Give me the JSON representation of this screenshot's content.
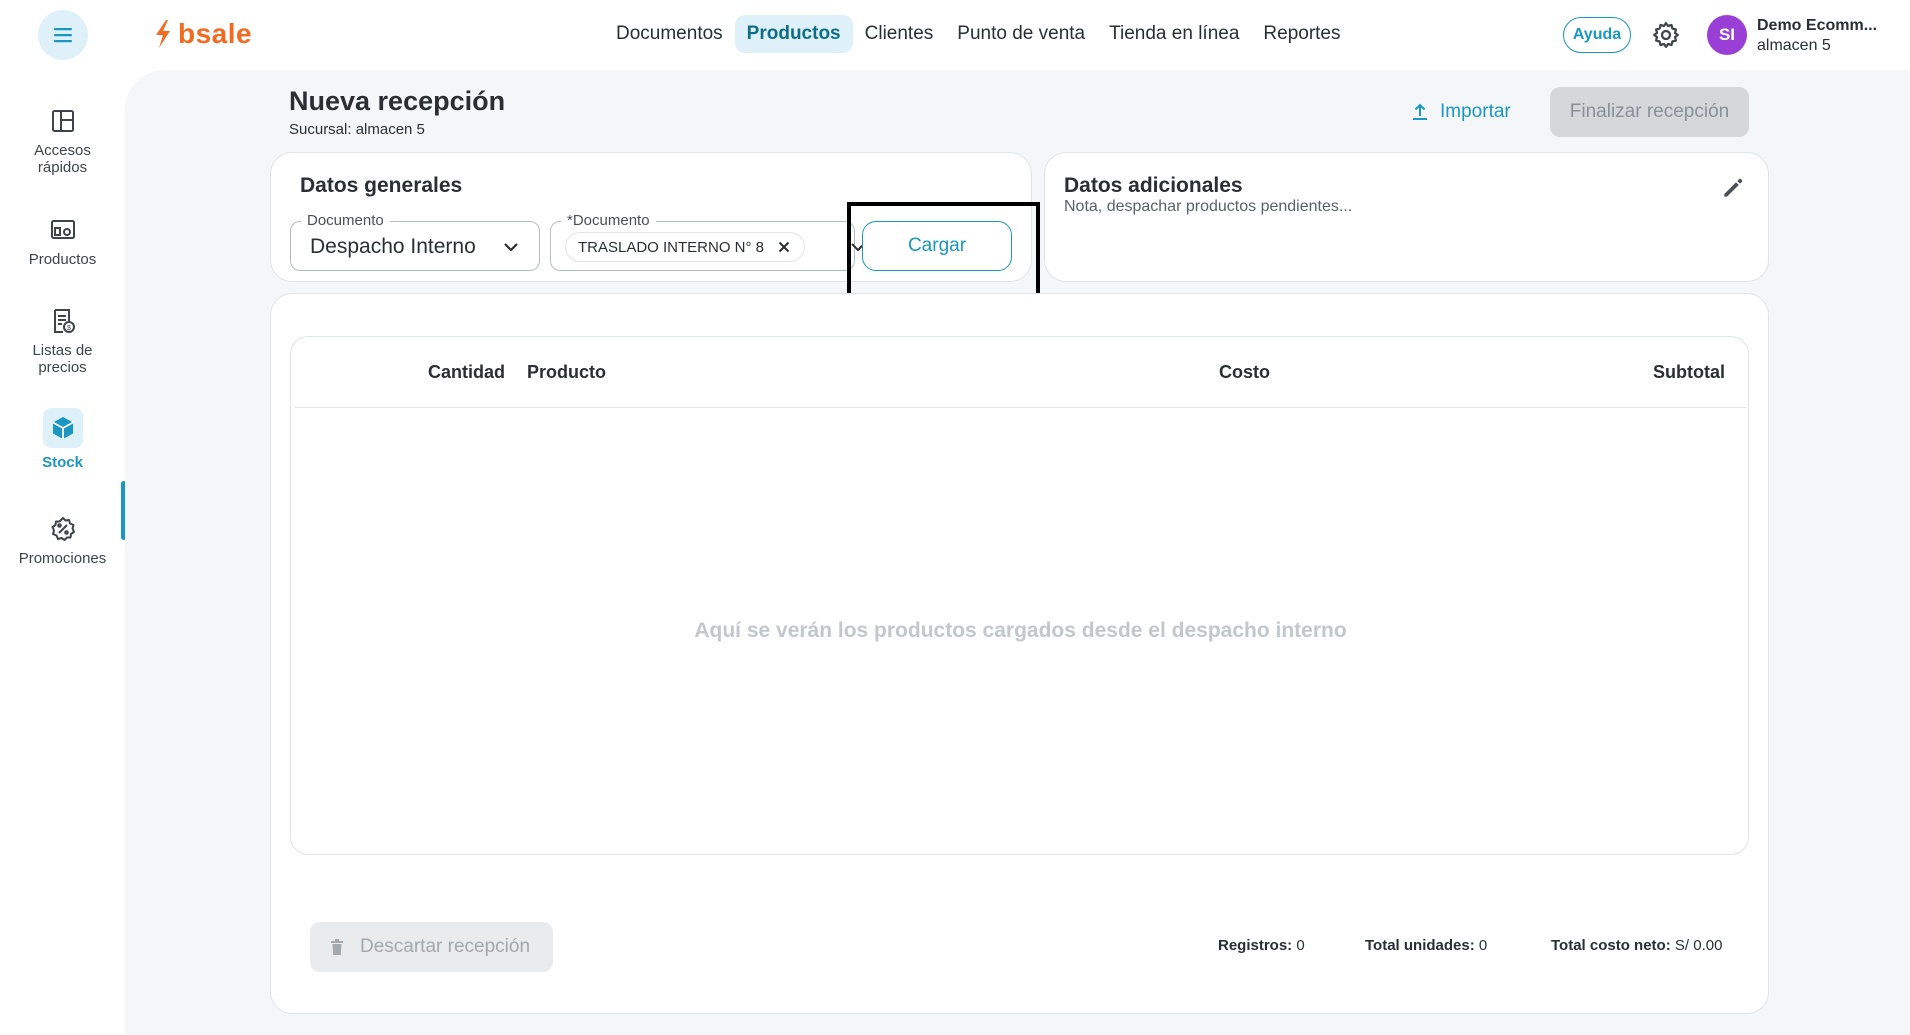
{
  "brand": {
    "name": "bsale",
    "color": "#f26b21"
  },
  "accent": "#1a97c2",
  "nav": {
    "items": [
      {
        "label": "Documentos",
        "active": false
      },
      {
        "label": "Productos",
        "active": true
      },
      {
        "label": "Clientes",
        "active": false
      },
      {
        "label": "Punto de venta",
        "active": false
      },
      {
        "label": "Tienda en línea",
        "active": false
      },
      {
        "label": "Reportes",
        "active": false
      }
    ]
  },
  "header": {
    "help_label": "Ayuda",
    "avatar_initials": "SI",
    "account_name": "Demo Ecomm...",
    "account_branch": "almacen 5"
  },
  "sidebar": {
    "items": [
      {
        "label_line1": "Accesos",
        "label_line2": "rápidos",
        "icon": "layout-icon"
      },
      {
        "label_line1": "Productos",
        "label_line2": "",
        "icon": "products-icon"
      },
      {
        "label_line1": "Listas de",
        "label_line2": "precios",
        "icon": "price-list-icon"
      },
      {
        "label_line1": "Stock",
        "label_line2": "",
        "icon": "box-icon",
        "active": true
      },
      {
        "label_line1": "Promociones",
        "label_line2": "",
        "icon": "discount-icon"
      }
    ]
  },
  "page": {
    "title": "Nueva recepción",
    "subtitle": "Sucursal: almacen 5",
    "import_label": "Importar",
    "finish_label": "Finalizar recepción"
  },
  "general": {
    "title": "Datos generales",
    "doc_type_label": "Documento",
    "doc_type_value": "Despacho Interno",
    "doc_number_label": "*Documento",
    "doc_number_chip": "TRASLADO INTERNO N° 8",
    "load_label": "Cargar"
  },
  "extra": {
    "title": "Datos adicionales",
    "subtitle": "Nota, despachar productos pendientes..."
  },
  "table": {
    "columns": [
      "Cantidad",
      "Producto",
      "Costo",
      "Subtotal"
    ],
    "rows": [],
    "empty_message": "Aquí se verán los productos cargados desde el despacho interno"
  },
  "footer": {
    "discard_label": "Descartar recepción",
    "records_label": "Registros:",
    "records_value": "0",
    "units_label": "Total unidades:",
    "units_value": "0",
    "cost_label": "Total costo neto:",
    "cost_value": "S/ 0.00"
  }
}
